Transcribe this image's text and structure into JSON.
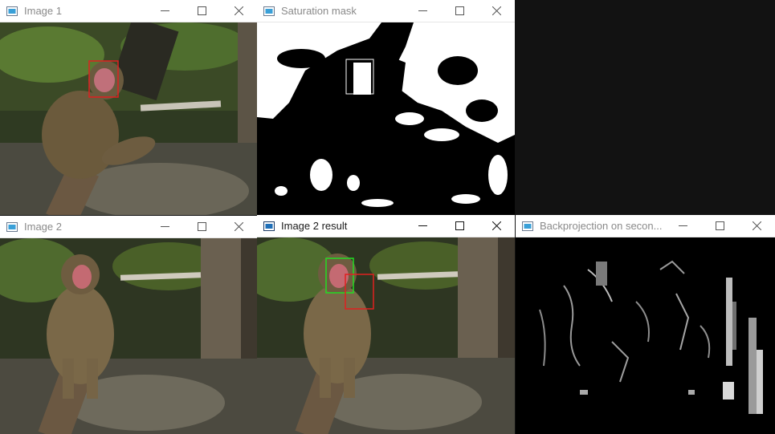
{
  "windows": {
    "image1": {
      "title": "Image 1",
      "active": false
    },
    "saturation_mask": {
      "title": "Saturation mask",
      "active": false
    },
    "image2": {
      "title": "Image 2",
      "active": false
    },
    "image2_result": {
      "title": "Image 2 result",
      "active": true
    },
    "backprojection": {
      "title": "Backprojection on secon...",
      "active": false
    }
  },
  "colors": {
    "face_box": "#e02020",
    "result_box_green": "#22dd22",
    "result_box_red": "#e02020",
    "mask_box": "#ffffff",
    "desktop": "#121212"
  },
  "icons": {
    "app": "opencv-window-icon",
    "minimize": "minimize-icon",
    "maximize": "maximize-icon",
    "close": "close-icon"
  }
}
